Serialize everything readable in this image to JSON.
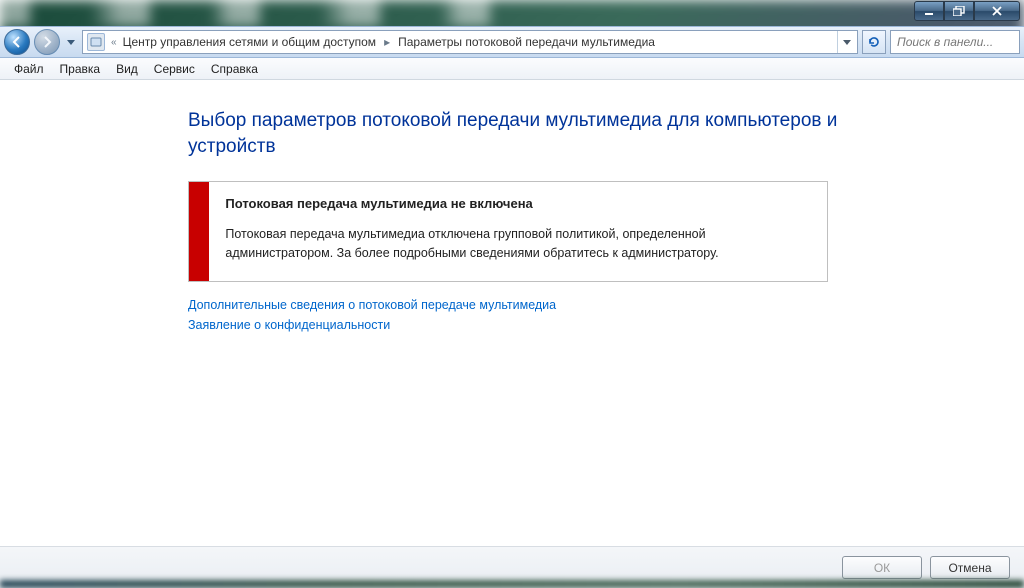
{
  "window_controls": {
    "minimize": "minimize",
    "restore": "restore",
    "close": "close"
  },
  "breadcrumb": {
    "prefix_glyph": "«",
    "segments": [
      "Центр управления сетями и общим доступом",
      "Параметры потоковой передачи мультимедиа"
    ]
  },
  "search": {
    "placeholder": "Поиск в панели..."
  },
  "menubar": [
    "Файл",
    "Правка",
    "Вид",
    "Сервис",
    "Справка"
  ],
  "page_title": "Выбор параметров потоковой передачи мультимедиа для компьютеров и устройств",
  "alert": {
    "heading": "Потоковая передача мультимедиа не включена",
    "text": "Потоковая передача мультимедиа отключена групповой политикой, определенной администратором. За более подробными сведениями обратитесь к администратору."
  },
  "links": [
    "Дополнительные сведения о потоковой передаче мультимедиа",
    "Заявление о конфиденциальности"
  ],
  "footer": {
    "ok": "ОК",
    "cancel": "Отмена"
  }
}
